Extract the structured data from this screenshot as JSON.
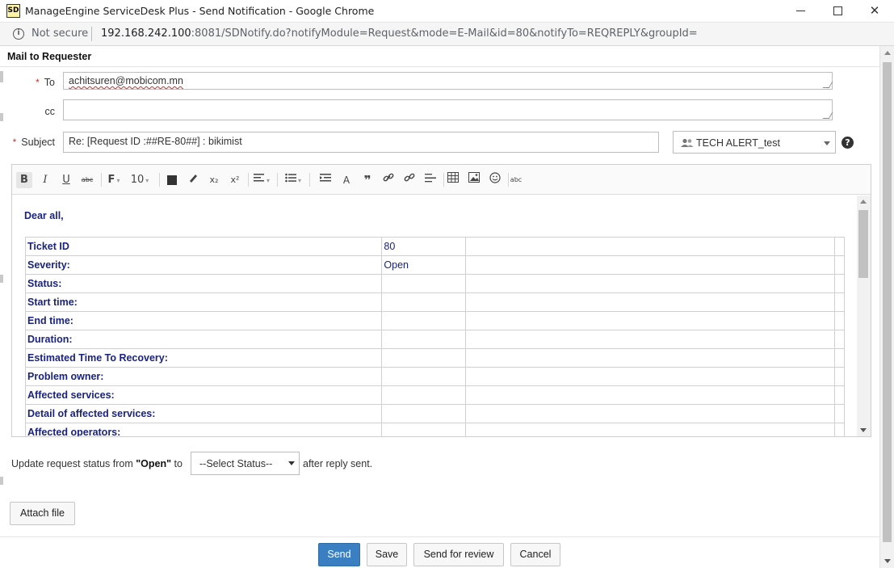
{
  "window": {
    "title": "ManageEngine ServiceDesk Plus - Send Notification - Google Chrome",
    "logo_text": "SD",
    "minimize": "minimize",
    "maximize": "maximize",
    "close": "✕"
  },
  "address_bar": {
    "security_label": "Not secure",
    "url_host": "192.168.242.100",
    "url_rest": ":8081/SDNotify.do?notifyModule=Request&mode=E-Mail&id=80&notifyTo=REQREPLY&groupId="
  },
  "dialog": {
    "title": "Mail to Requester"
  },
  "form": {
    "to_label": "To",
    "to_value": "achitsuren@mobicom.mn",
    "cc_label": "cc",
    "cc_value": "",
    "subject_label": "Subject",
    "subject_value": "Re: [Request ID :##RE-80##] : bikimist",
    "template_selected": "TECH ALERT_test",
    "help_symbol": "?",
    "required_mark": "*"
  },
  "toolbar": {
    "bold": "B",
    "italic": "I",
    "underline": "U",
    "strike": "abc",
    "font": "F",
    "size": "10",
    "subscript": "x₂",
    "superscript": "x²",
    "quote": "❞",
    "spell": "abc",
    "format_text": "A"
  },
  "editor": {
    "greeting": "Dear all,",
    "rows": [
      {
        "key": "Ticket ID",
        "value": "80"
      },
      {
        "key": "Severity:",
        "value": "Open"
      },
      {
        "key": "Status:",
        "value": ""
      },
      {
        "key": "Start time:",
        "value": ""
      },
      {
        "key": "End time:",
        "value": ""
      },
      {
        "key": "Duration:",
        "value": ""
      },
      {
        "key": "Estimated Time To Recovery:",
        "value": ""
      },
      {
        "key": "Problem owner:",
        "value": ""
      },
      {
        "key": "Affected services:",
        "value": ""
      },
      {
        "key": "Detail of affected services:",
        "value": ""
      },
      {
        "key": "Affected operators:",
        "value": ""
      }
    ]
  },
  "status_update": {
    "prefix": "Update request status from ",
    "current": "\"Open\"",
    "to_word": " to",
    "select_placeholder": "--Select Status--",
    "suffix": "after reply sent."
  },
  "buttons": {
    "attach": "Attach file",
    "send": "Send",
    "save": "Save",
    "send_review": "Send for review",
    "cancel": "Cancel"
  },
  "colors": {
    "primary_button": "#3a7fc1",
    "editor_text": "#1a237e",
    "required": "#d32f2f"
  }
}
